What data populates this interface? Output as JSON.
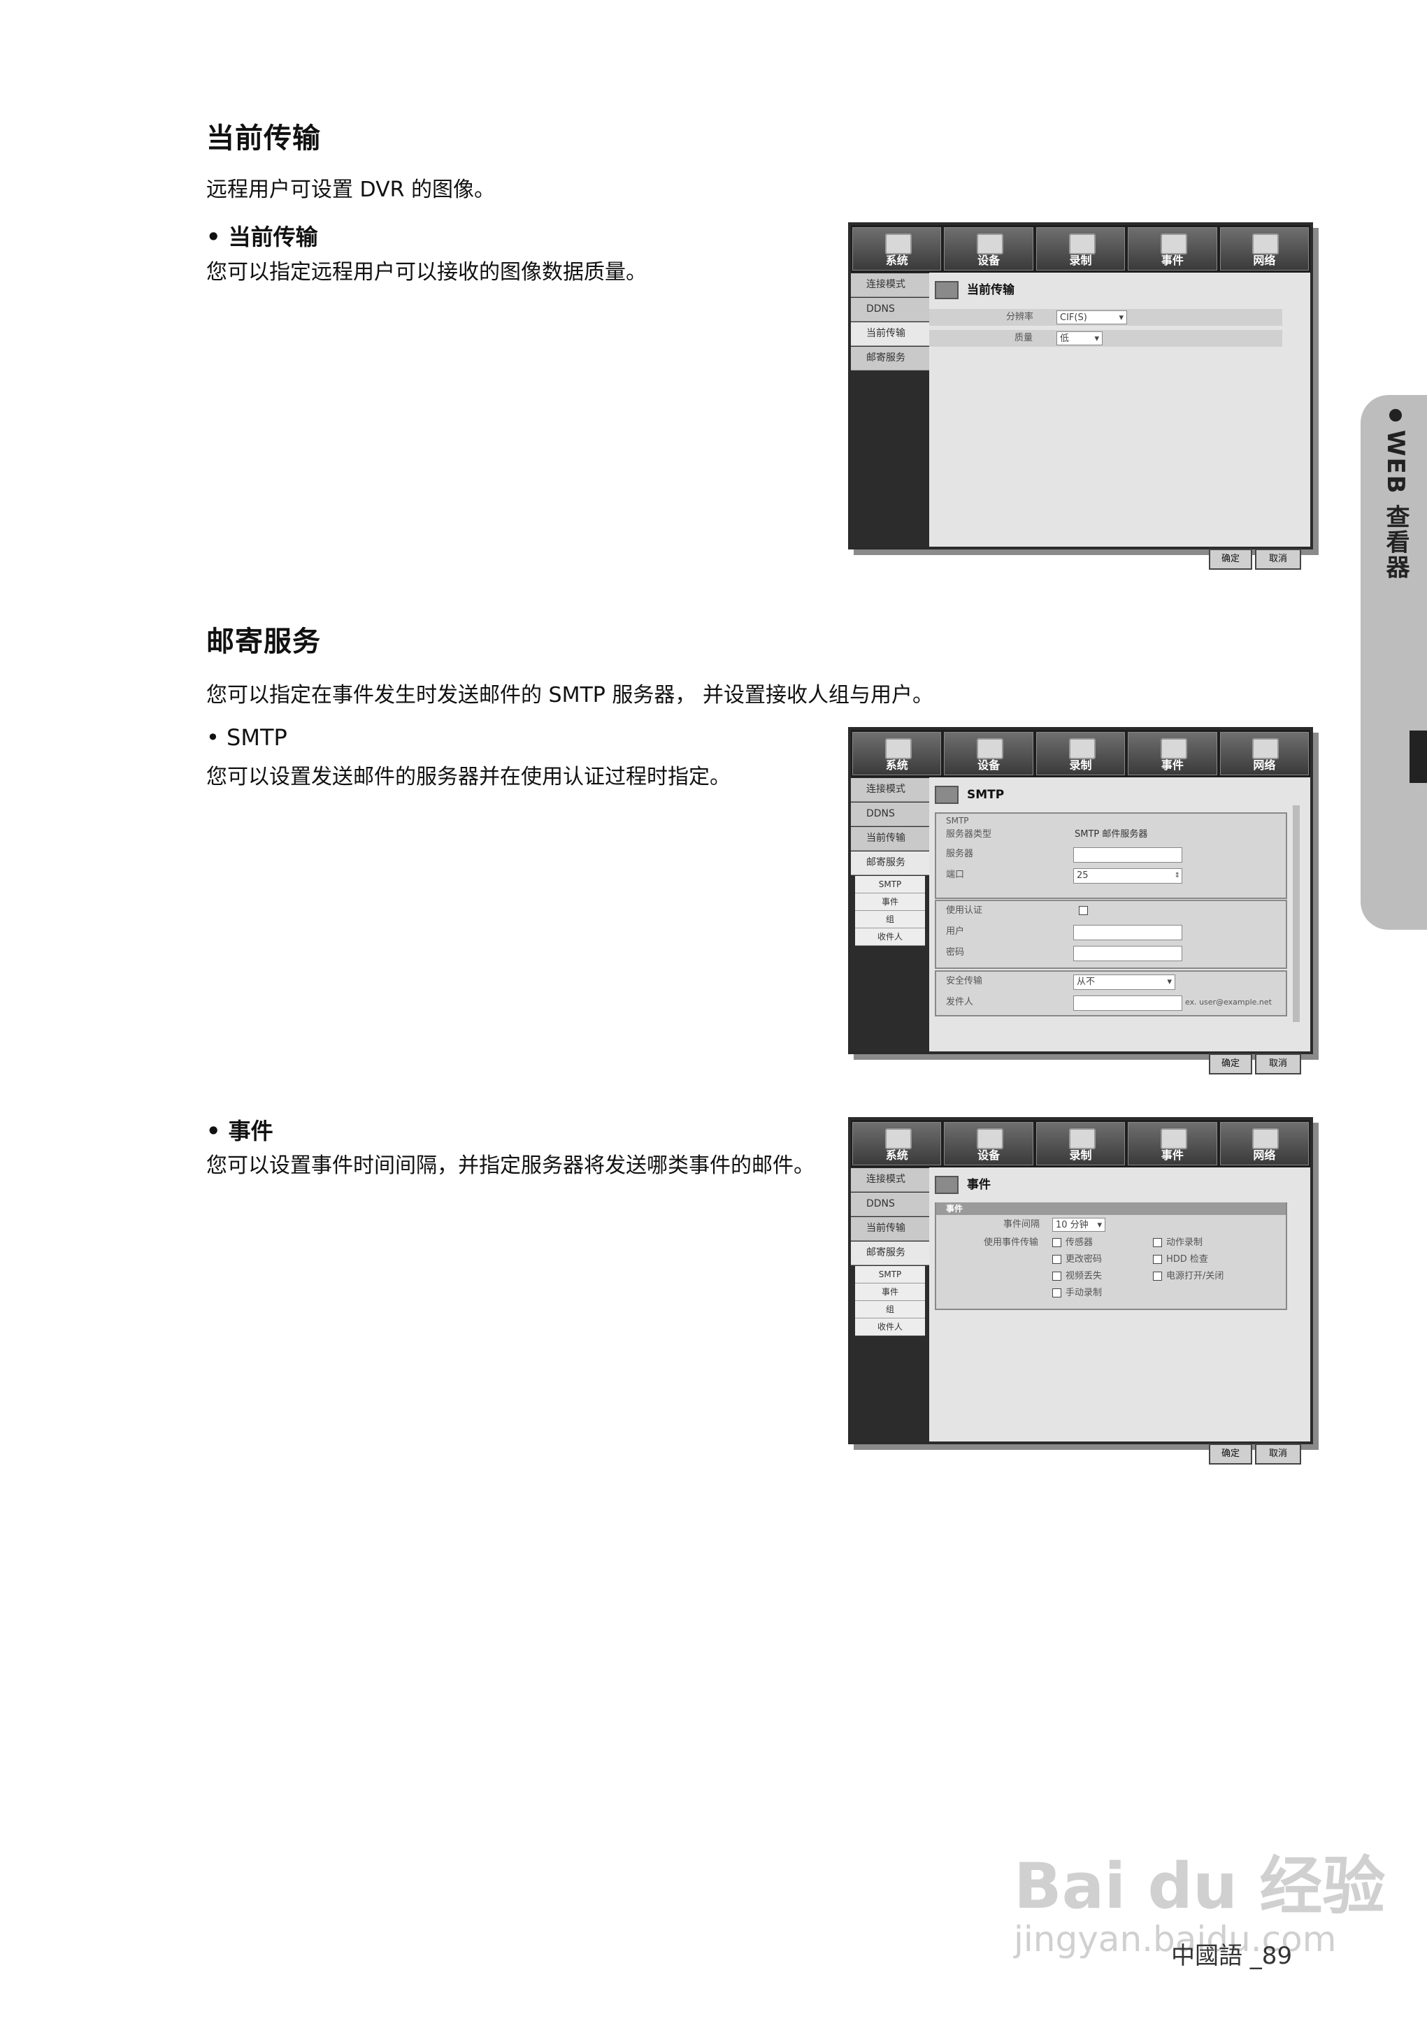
{
  "section1": {
    "title": "当前传输",
    "intro": "远程用户可设置 DVR 的图像。",
    "bullet": "• 当前传输",
    "desc": "您可以指定远程用户可以接收的图像数据质量。"
  },
  "section2": {
    "title": "邮寄服务",
    "intro": "您可以指定在事件发生时发送邮件的 SMTP 服务器，  并设置接收人组与用户。",
    "bullet": "• SMTP",
    "desc": "您可以设置发送邮件的服务器并在使用认证过程时指定。"
  },
  "section3": {
    "bullet": "• 事件",
    "desc": "您可以设置事件时间间隔，并指定服务器将发送哪类事件的邮件。"
  },
  "side_tab": "WEB 查看器",
  "page_number": "中國語 _89",
  "watermark": {
    "logo": "Bai du 经验",
    "url": "jingyan.baidu.com"
  },
  "dvr": {
    "tabs": [
      "系统",
      "设备",
      "录制",
      "事件",
      "网络"
    ],
    "nav": [
      "连接模式",
      "DDNS",
      "当前传输",
      "邮寄服务"
    ],
    "subnav": [
      "SMTP",
      "事件",
      "组",
      "收件人"
    ],
    "ok": "确定",
    "cancel": "取消",
    "shot1": {
      "title": "当前传输",
      "resolution_label": "分辨率",
      "resolution_value": "CIF(S)",
      "quality_label": "质量",
      "quality_value": "低"
    },
    "shot2": {
      "title": "SMTP",
      "group": "SMTP",
      "server_type_label": "服务器类型",
      "server_type_value": "SMTP 邮件服务器",
      "server_label": "服务器",
      "port_label": "端口",
      "port_value": "25",
      "auth_label": "使用认证",
      "user_label": "用户",
      "password_label": "密码",
      "secure_label": "安全传输",
      "secure_value": "从不",
      "sender_label": "发件人",
      "sender_hint": "ex. user@example.net"
    },
    "shot3": {
      "title": "事件",
      "group": "事件",
      "interval_label": "事件间隔",
      "interval_value": "10 分钟",
      "use_label": "使用事件传输",
      "events": [
        "传感器",
        "动作录制",
        "更改密码",
        "HDD 检查",
        "视频丢失",
        "电源打开/关闭",
        "手动录制"
      ]
    }
  }
}
